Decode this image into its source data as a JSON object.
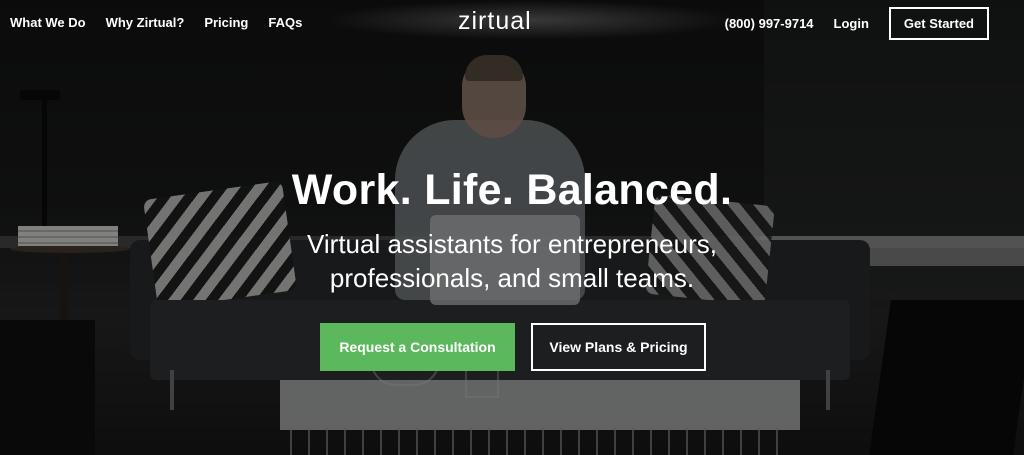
{
  "nav": {
    "links": [
      {
        "label": "What We Do"
      },
      {
        "label": "Why Zirtual?"
      },
      {
        "label": "Pricing"
      },
      {
        "label": "FAQs"
      }
    ],
    "logo": "zirtual",
    "phone": "(800) 997-9714",
    "login": "Login",
    "cta": "Get Started"
  },
  "hero": {
    "headline": "Work. Life. Balanced.",
    "subhead_line1": "Virtual assistants for entrepreneurs,",
    "subhead_line2": "professionals, and small teams.",
    "primary_button": "Request a Consultation",
    "secondary_button": "View Plans & Pricing"
  },
  "colors": {
    "accent_green": "#5cb85c",
    "text": "#ffffff"
  }
}
